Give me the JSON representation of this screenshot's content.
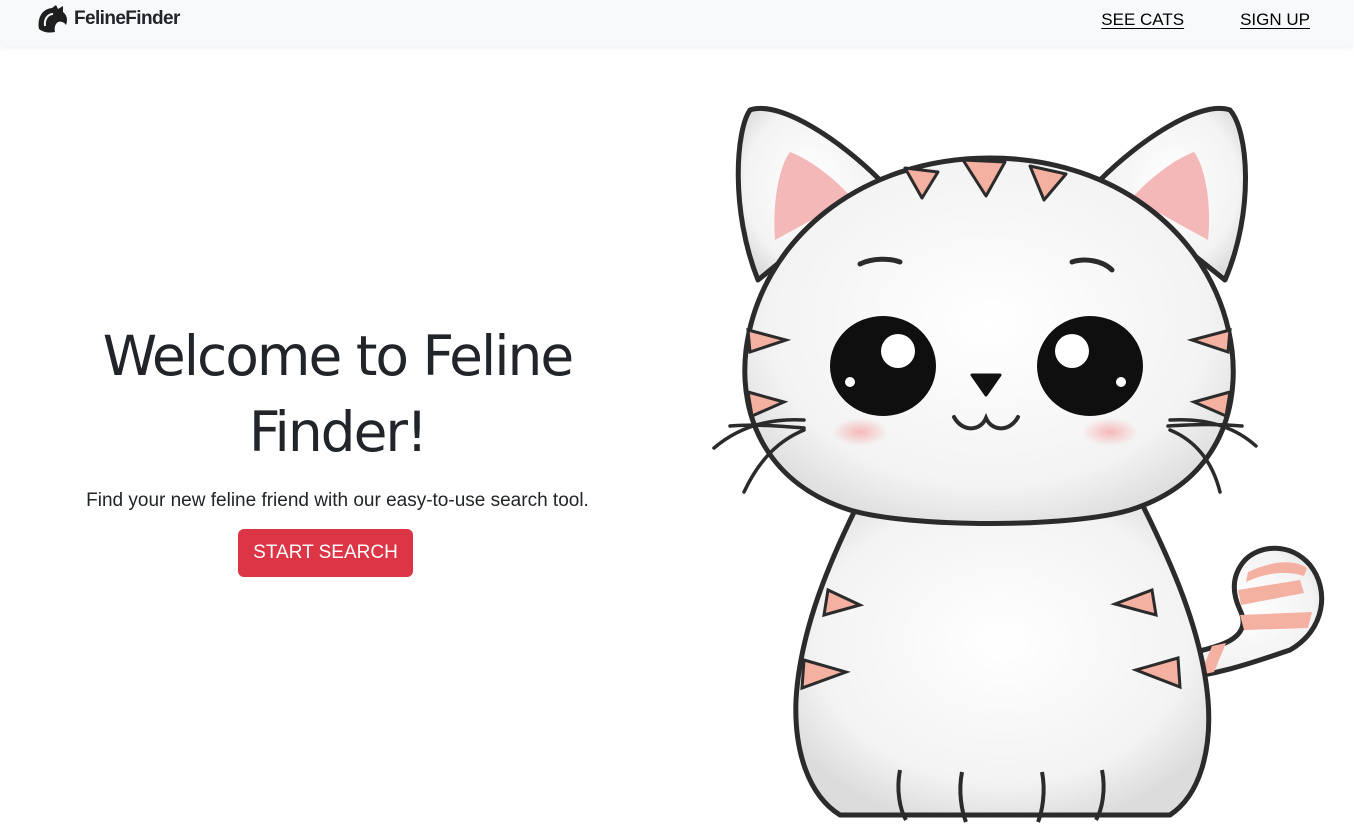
{
  "navbar": {
    "brand_text": "FelineFinder",
    "brand_icon": "cat-silhouette-icon",
    "links": [
      "SEE CATS",
      "SIGN UP"
    ],
    "background": "#f8f9fa"
  },
  "hero": {
    "title": "Welcome to Feline Finder!",
    "subtitle": "Find your new feline friend with our easy-to-use search tool.",
    "cta_label": "START SEARCH",
    "cta_color": "#dc3545"
  },
  "illustration": {
    "subject": "cartoon-kitten-illustration",
    "stripe_color": "#f4b0a0",
    "outline_color": "#2b2b2b"
  }
}
